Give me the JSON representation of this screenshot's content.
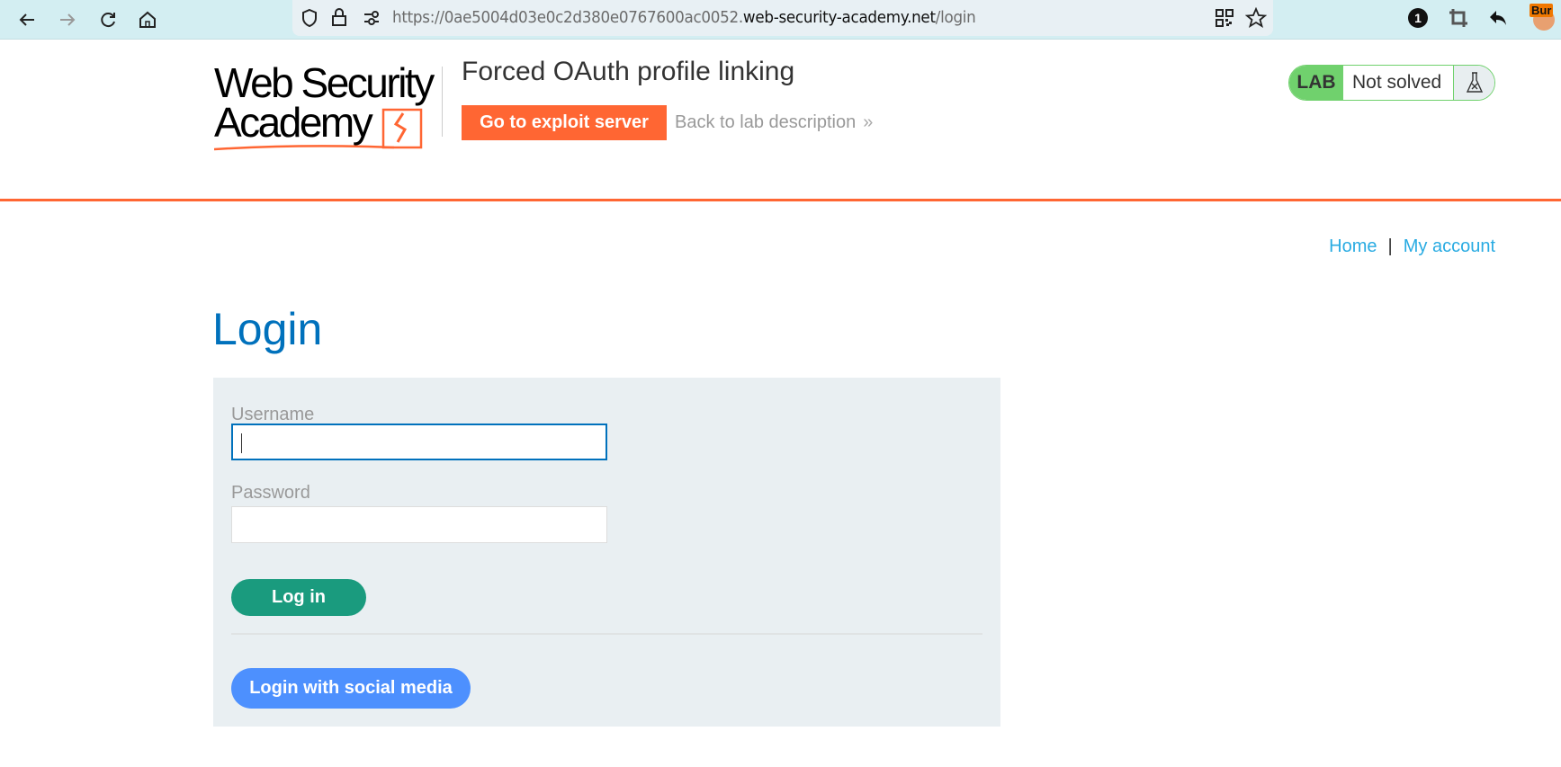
{
  "browser": {
    "url_prefix": "https://0ae5004d03e0c2d380e0767600ac0052.",
    "url_domain": "web-security-academy.net",
    "url_path": "/login",
    "notification_count": "1",
    "extension_label": "Bur"
  },
  "header": {
    "logo_line1": "Web Security",
    "logo_line2": "Academy",
    "lab_title": "Forced OAuth profile linking",
    "exploit_button": "Go to exploit server",
    "back_link": "Back to lab description",
    "back_chevron": "»",
    "lab_badge": {
      "label": "LAB",
      "status": "Not solved"
    }
  },
  "nav": {
    "home": "Home",
    "separator": "|",
    "my_account": "My account"
  },
  "login": {
    "heading": "Login",
    "username_label": "Username",
    "username_value": "",
    "password_label": "Password",
    "password_value": "",
    "login_button": "Log in",
    "social_button": "Login with social media"
  },
  "colors": {
    "brand_orange": "#ff6633",
    "heading_blue": "#0071bc",
    "link_blue": "#29abe2",
    "login_green": "#1a9b7e",
    "social_blue": "#4d90fe",
    "lab_green": "#70d16d",
    "panel_bg": "#e9eff2"
  }
}
